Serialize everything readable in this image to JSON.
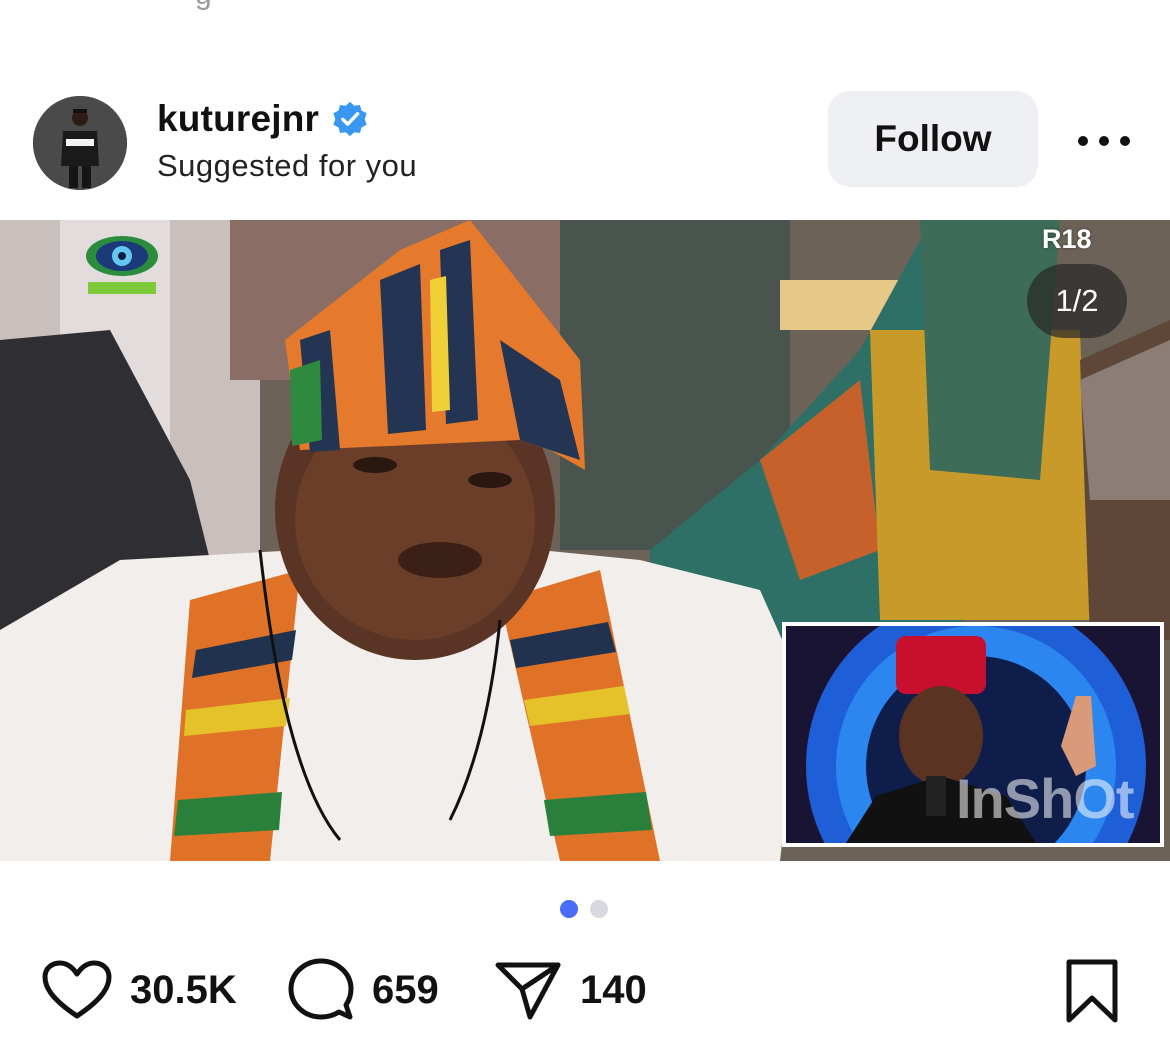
{
  "top_partial_text": "g",
  "post": {
    "username": "kuturejnr",
    "subtitle": "Suggested for you",
    "follow_label": "Follow",
    "media": {
      "rating": "R18",
      "page_counter": "1/2",
      "pip_watermark": "InShOt"
    },
    "carousel": {
      "total": 2,
      "active_index": 0
    },
    "actions": {
      "likes": "30.5K",
      "comments": "659",
      "shares": "140"
    }
  },
  "colors": {
    "accent_blue": "#4a6cf7",
    "verified_blue": "#3897f0",
    "follow_bg": "#eff0f3",
    "text": "#111111"
  },
  "icons": {
    "verified": "verified-badge-icon",
    "more": "more-horizontal-icon",
    "like": "heart-icon",
    "comment": "comment-bubble-icon",
    "share": "paper-plane-icon",
    "save": "bookmark-icon"
  }
}
